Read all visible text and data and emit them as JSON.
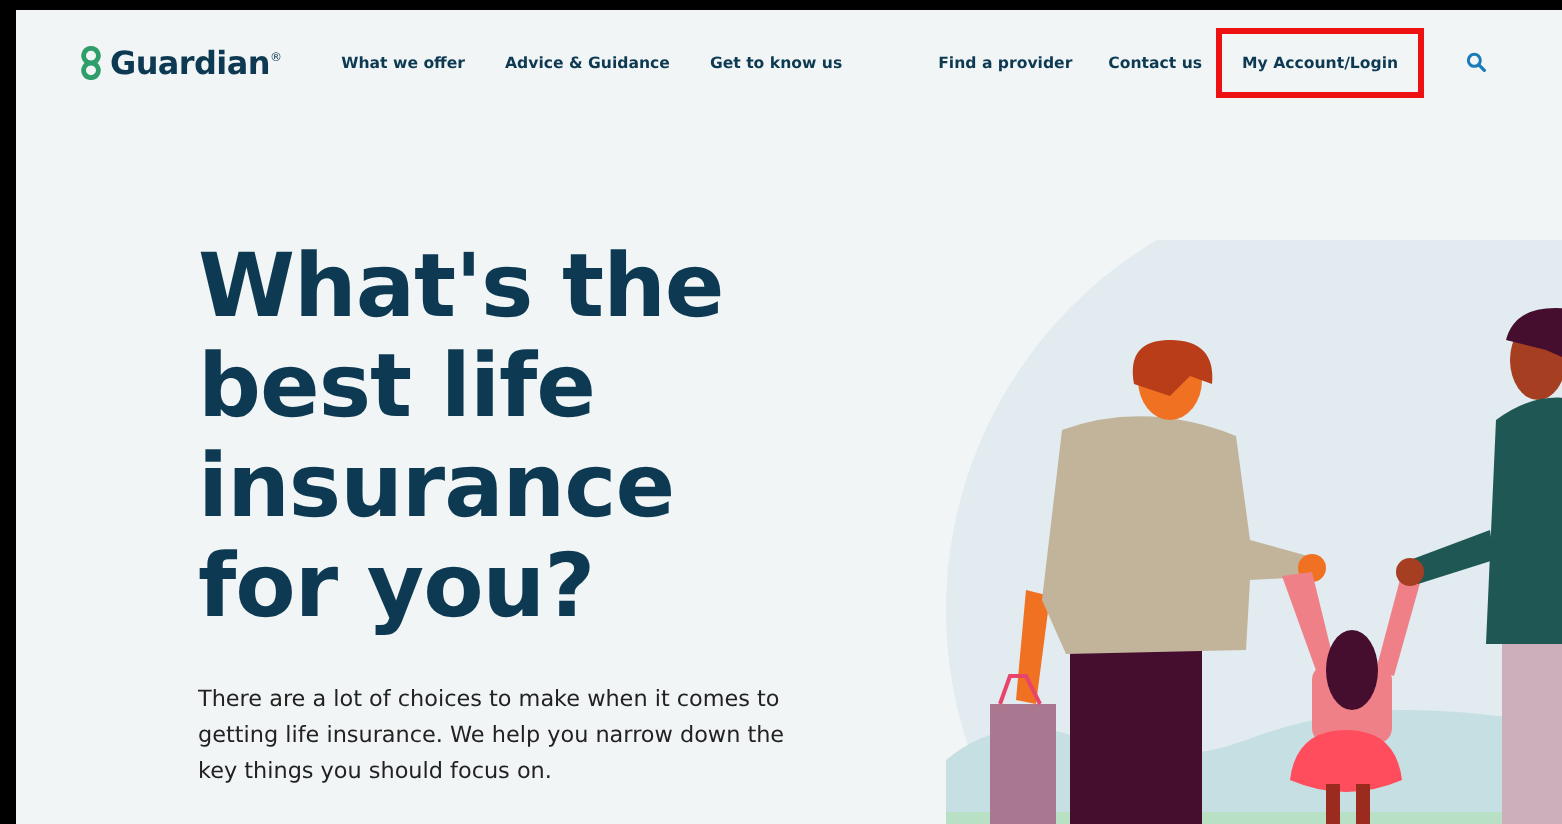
{
  "header": {
    "logo_text": "Guardian$^{®}$",
    "nav_main": [
      {
        "label": "What we offer"
      },
      {
        "label": "Advice & Guidance"
      },
      {
        "label": "Get to know us"
      }
    ],
    "nav_utility": [
      {
        "label": "Find a provider",
        "highlighted": false
      },
      {
        "label": "Contact us",
        "highlighted": false
      },
      {
        "label": "My Account/Login",
        "highlighted": true
      }
    ]
  },
  "hero": {
    "heading": [
      "What's the",
      "best life",
      "insurance",
      "for you?"
    ],
    "body": "There are a lot of choices to make when it comes to getting life insurance. We help you narrow down the key things you should focus on."
  }
}
